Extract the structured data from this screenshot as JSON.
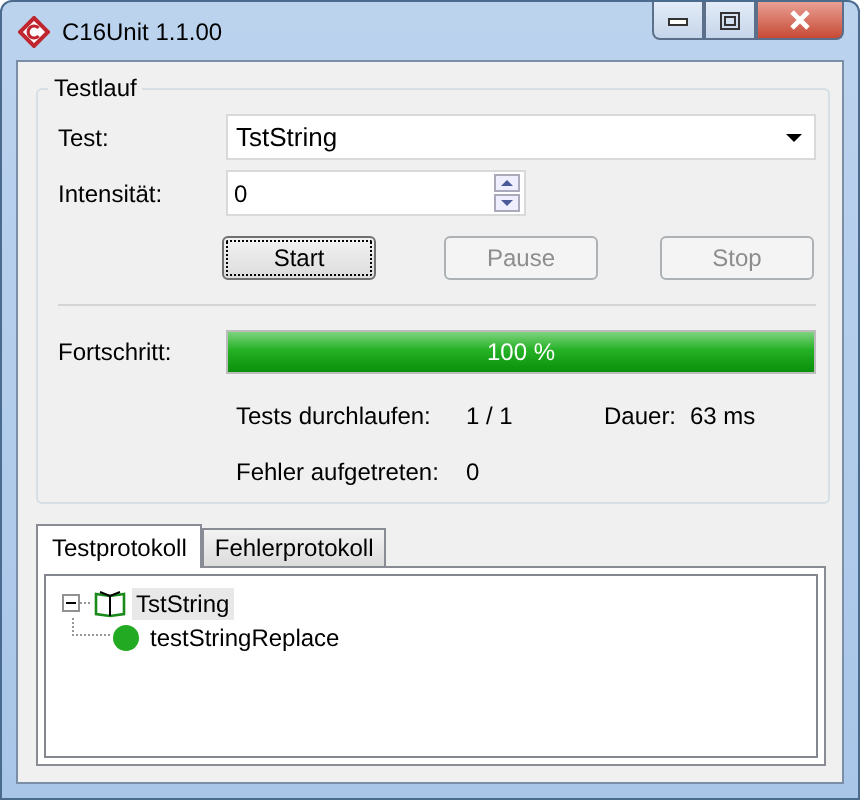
{
  "window": {
    "title": "C16Unit 1.1.00"
  },
  "group": {
    "title": "Testlauf"
  },
  "test": {
    "label": "Test:",
    "value": "TstString"
  },
  "intensity": {
    "label": "Intensität:",
    "value": "0"
  },
  "buttons": [
    {
      "label": "Start",
      "disabled": false
    },
    {
      "label": "Pause",
      "disabled": true
    },
    {
      "label": "Stop",
      "disabled": true
    }
  ],
  "progress": {
    "label": "Fortschritt:",
    "level": 1,
    "reading": "100 %"
  },
  "stats": [
    {
      "label": "Tests durchlaufen:",
      "value": "1 / 1"
    },
    {
      "label": "Dauer:",
      "value": "63 ms"
    },
    {
      "label": "Fehler aufgetreten:",
      "value": "0"
    }
  ],
  "tabs": [
    {
      "label": "Testprotokoll",
      "selected": true
    },
    {
      "label": "Fehlerprotokoll",
      "selected": false
    }
  ],
  "tree": [
    {
      "label": "TstString",
      "kind": "suite",
      "expanded": true,
      "selected": true,
      "children": [
        {
          "label": "testStringReplace",
          "kind": "test",
          "selected": false,
          "color": "#22aa22"
        }
      ]
    }
  ]
}
